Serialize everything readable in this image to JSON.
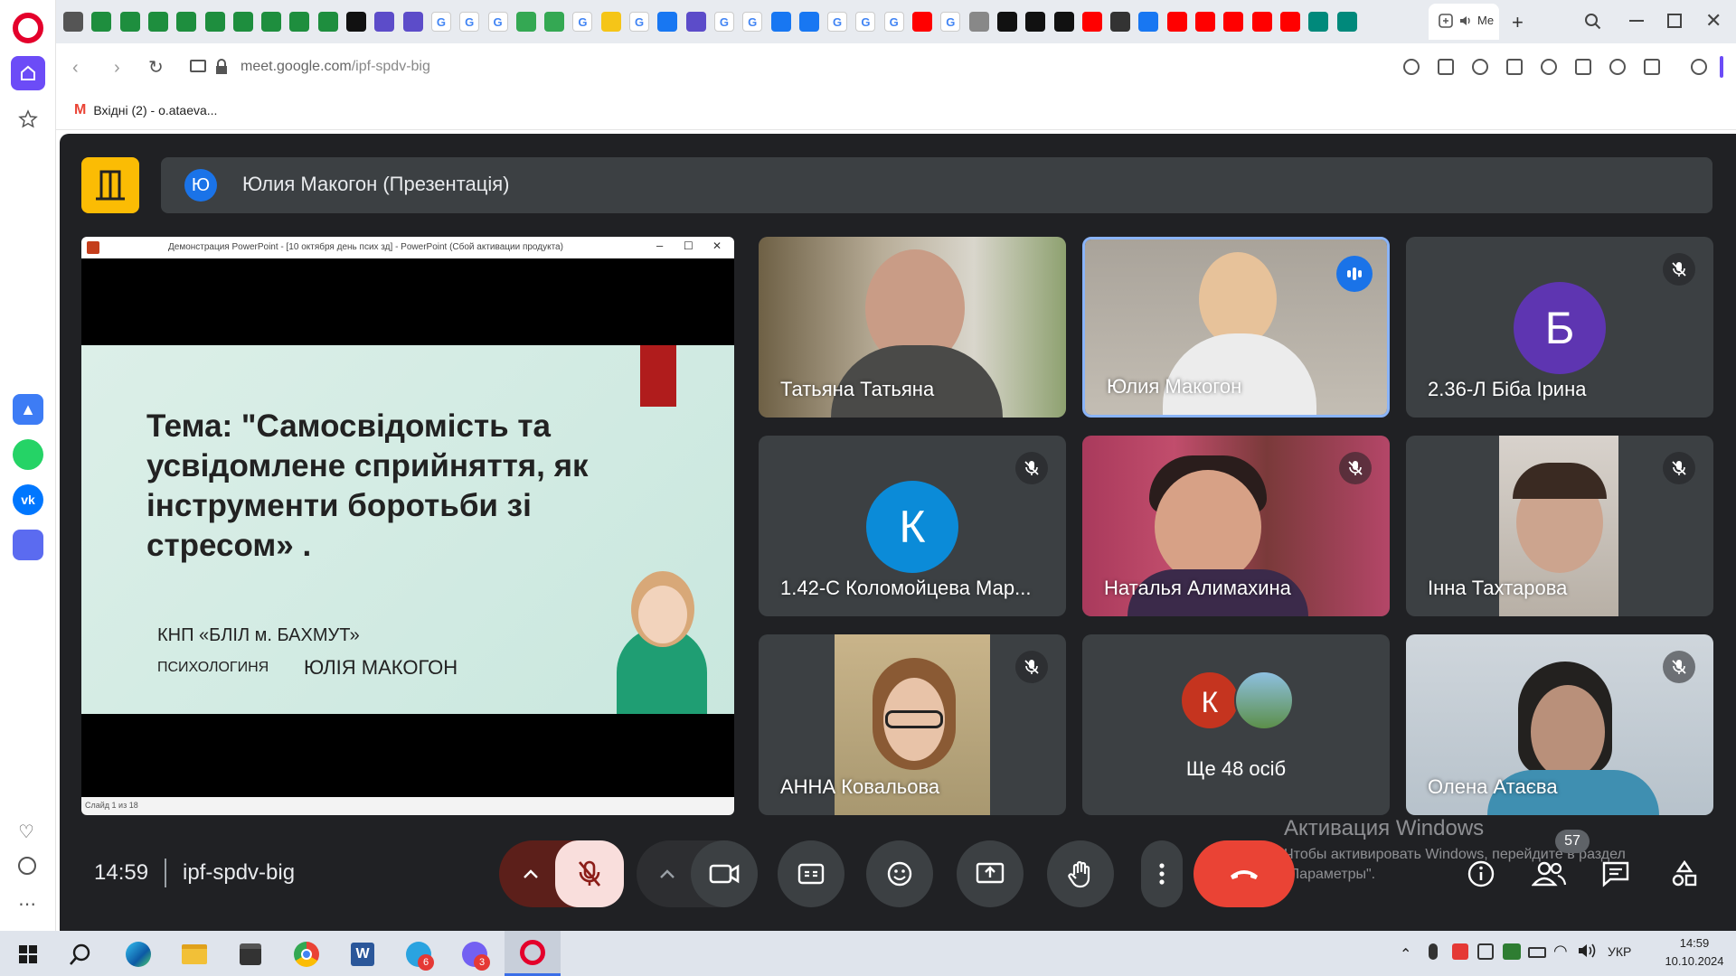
{
  "browser": {
    "url_host": "meet.google.com",
    "url_path": "/ipf-spdv-big",
    "active_tab_label": "Me",
    "bookmark_label": "Вхідні (2) - o.ataeva..."
  },
  "meet": {
    "presenter_initial": "Ю",
    "presenter_title": "Юлия Макогон (Презентація)",
    "time": "14:59",
    "meeting_code": "ipf-spdv-big",
    "people_count": "57",
    "others_label": "Ще 48 осіб"
  },
  "presentation": {
    "window_title": "Демонстрация PowerPoint - [10 октября день псих зд] - PowerPoint (Сбой активации продукта)",
    "slide_title": "Тема: \"Самосвідомість та усвідомлене сприйняття, як інструменти боротьби зі стресом» .",
    "org": "КНП «БЛІЛ м. БАХМУТ»",
    "role": "ПСИХОЛОГИНЯ",
    "author": "ЮЛІЯ МАКОГОН",
    "status": "Слайд 1 из 18"
  },
  "participants": [
    {
      "name": "Татьяна Татьяна"
    },
    {
      "name": "Юлия Макогон"
    },
    {
      "name": "2.36-Л Біба Ірина",
      "initial": "Б",
      "color": "#5e35b1"
    },
    {
      "name": "1.42-С Коломойцева Мар...",
      "initial": "К",
      "color": "#0b8bd8"
    },
    {
      "name": "Наталья Алимахина"
    },
    {
      "name": "Інна Тахтарова"
    },
    {
      "name": "АННА Ковальова"
    },
    {
      "name": "Олена Атаєва"
    }
  ],
  "others_avatar_initial": "К",
  "windows_activation": {
    "title": "Активация Windows",
    "line1": "Чтобы активировать Windows, перейдите в раздел",
    "line2": "\"Параметры\"."
  },
  "taskbar": {
    "lang": "УКР",
    "time": "14:59",
    "date": "10.10.2024",
    "telegram_badge": "6",
    "viber_badge": "3"
  },
  "colors": {
    "meet_bg": "#202124",
    "tile_bg": "#3c4043",
    "active_speaker_border": "#8ab4f8",
    "leave_red": "#ea4335",
    "mic_off_bg": "#f9dedc",
    "meet_logo": "#fbbc04"
  }
}
